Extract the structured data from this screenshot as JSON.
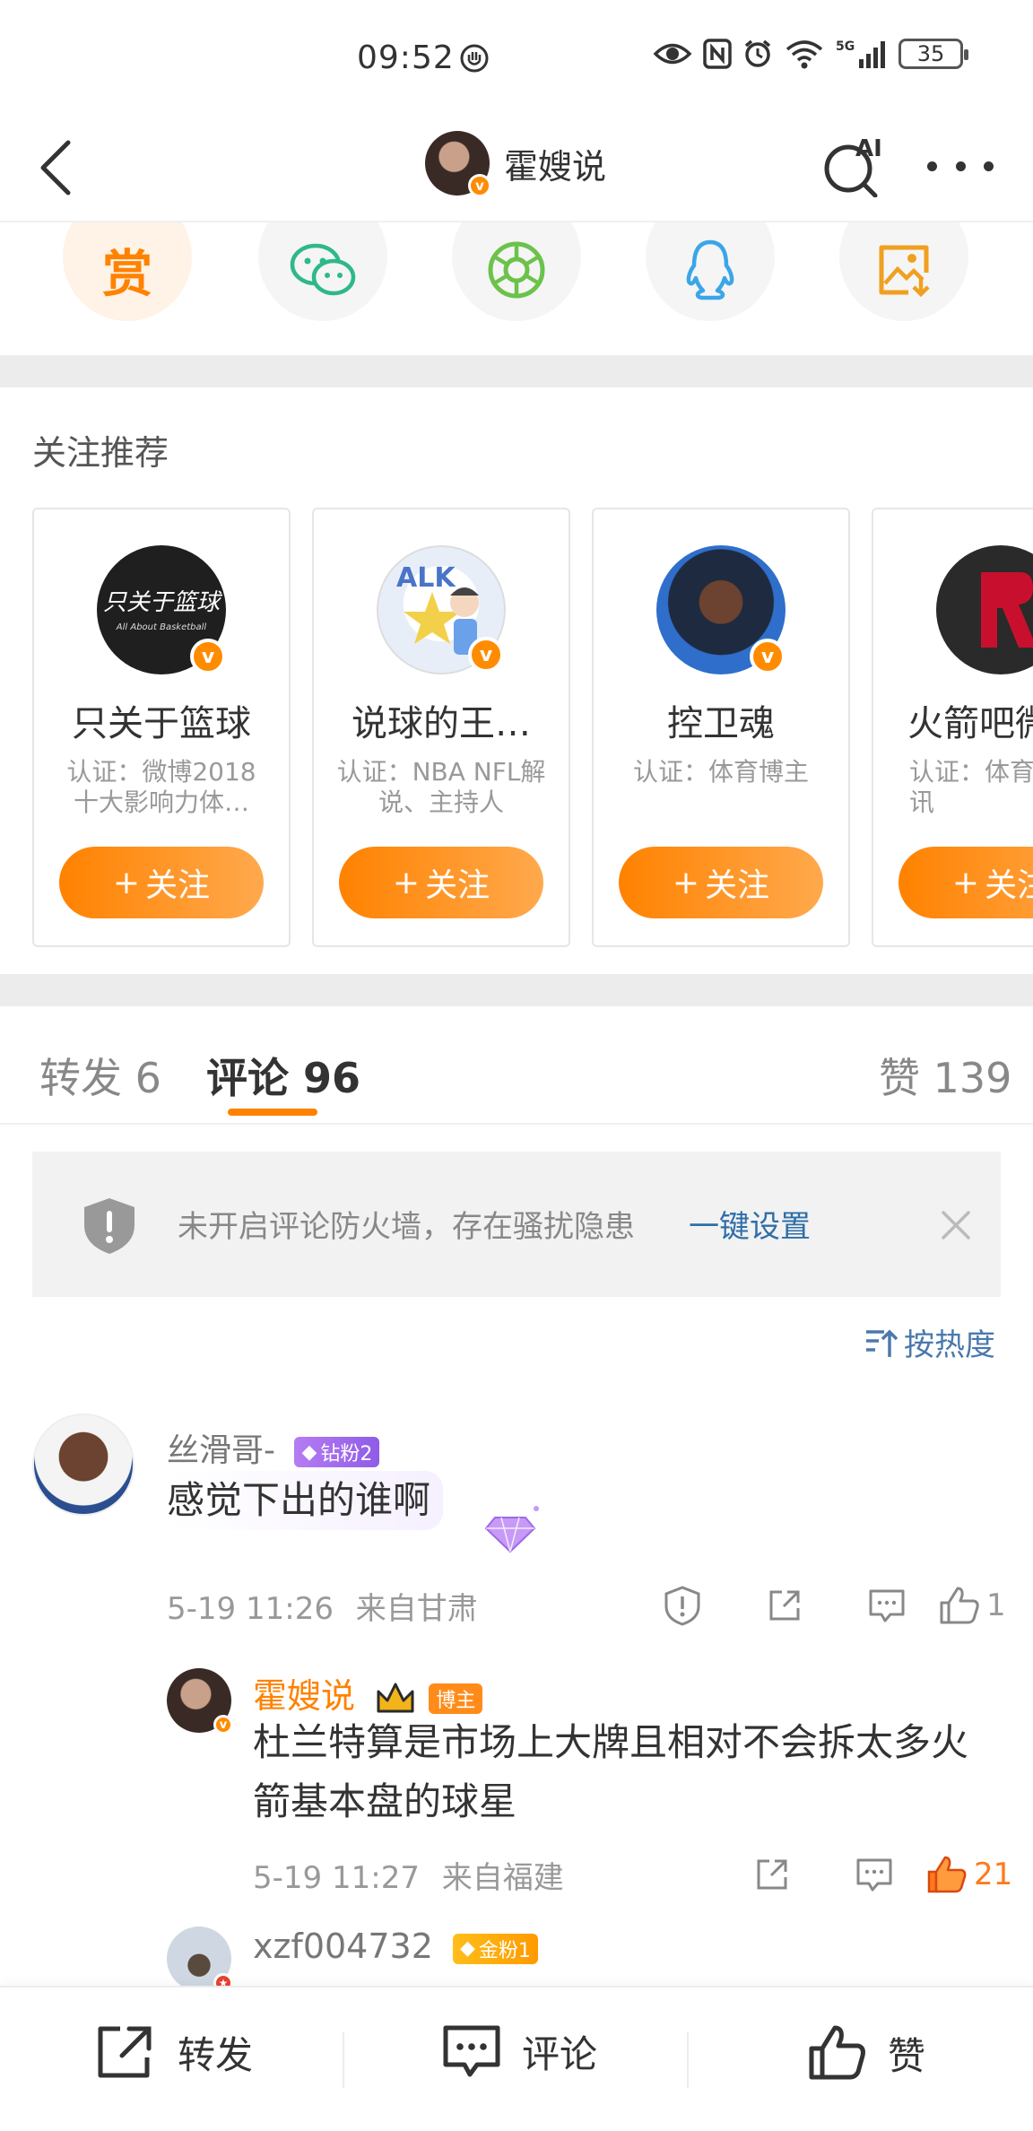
{
  "status_bar": {
    "time": "09:52",
    "network": "5G",
    "battery": "35"
  },
  "nav": {
    "title": "霍嫂说",
    "ai_label": "AI"
  },
  "share": {
    "items": [
      {
        "icon": "reward-icon",
        "label": "赏"
      },
      {
        "icon": "wechat-icon"
      },
      {
        "icon": "moments-icon"
      },
      {
        "icon": "qq-icon"
      },
      {
        "icon": "save-image-icon"
      }
    ]
  },
  "recommend": {
    "title": "关注推荐",
    "follow_label": "关注",
    "cards": [
      {
        "name": "只关于篮球",
        "desc": "认证：微博2018十大影响力体…",
        "avatar_text": "只关于篮球",
        "avatar_subtext": "All About Basketball"
      },
      {
        "name": "说球的王…",
        "desc": "认证：NBA NFL解说、主持人",
        "avatar_text": "ALK"
      },
      {
        "name": "控卫魂",
        "desc": "认证：体育博主"
      },
      {
        "name": "火箭吧微",
        "desc": "认证：体育火箭资讯"
      }
    ]
  },
  "tabs": {
    "repost": "转发 6",
    "comments": "评论 96",
    "likes": "赞 139"
  },
  "firewall": {
    "text": "未开启评论防火墙，存在骚扰隐患",
    "link": "一键设置"
  },
  "sort": {
    "label": "按热度"
  },
  "comments": [
    {
      "user": "丝滑哥-",
      "badge": "钻粉2",
      "text": "感觉下出的谁啊",
      "time": "5-19 11:26",
      "location": "来自甘肃",
      "likes": "1",
      "reply": {
        "user": "霍嫂说",
        "badge": "博主",
        "text": "杜兰特算是市场上大牌且相对不会拆太多火箭基本盘的球星",
        "time": "5-19 11:27",
        "location": "来自福建",
        "likes": "21"
      }
    },
    {
      "user": "xzf004732",
      "badge": "金粉1"
    }
  ],
  "bottom_bar": {
    "repost": "转发",
    "comment": "评论",
    "like": "赞"
  },
  "colors": {
    "accent": "#ff8200",
    "link": "#2f6ea8",
    "muted": "#999999"
  }
}
